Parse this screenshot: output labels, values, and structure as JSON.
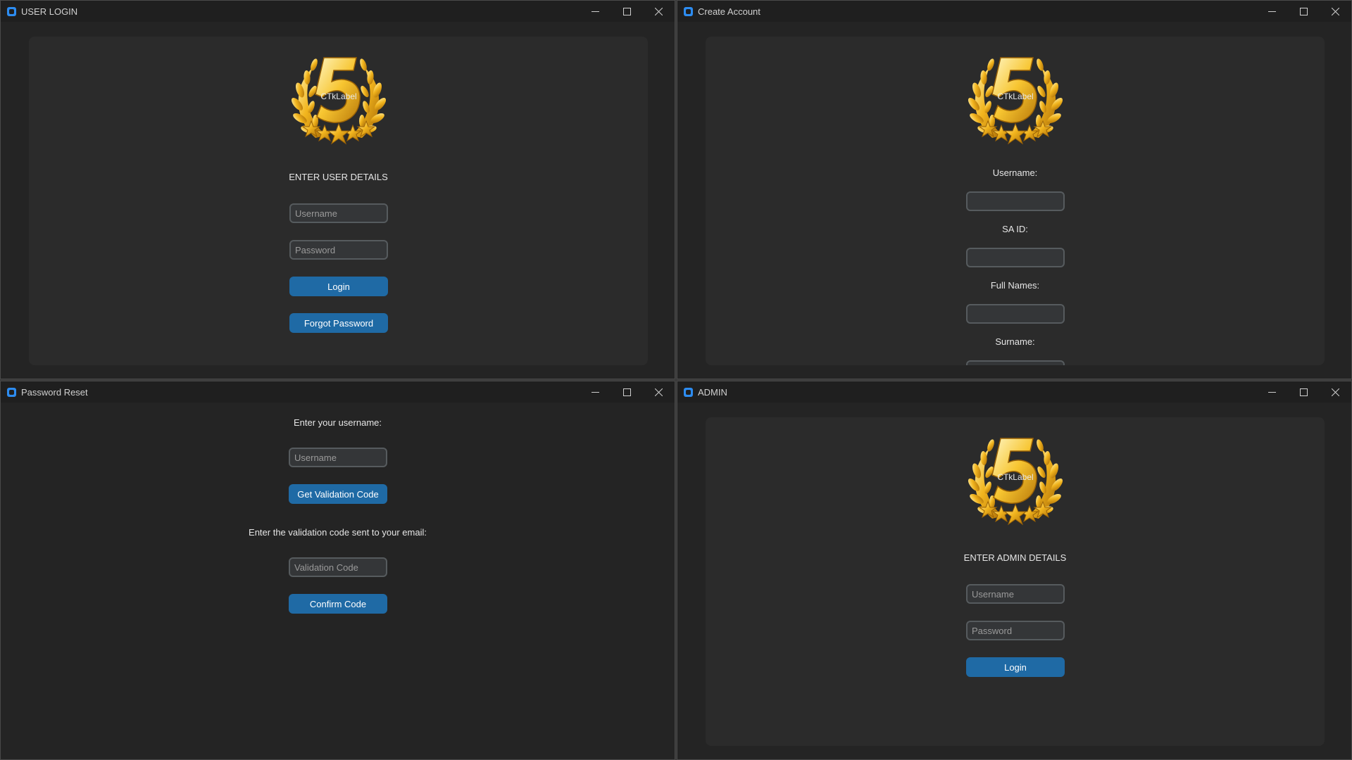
{
  "windows": {
    "login": {
      "title": "USER LOGIN",
      "logo_label": "CTkLabel",
      "heading": "ENTER USER DETAILS",
      "username_placeholder": "Username",
      "password_placeholder": "Password",
      "login_label": "Login",
      "forgot_label": "Forgot Password"
    },
    "create": {
      "title": "Create Account",
      "logo_label": "CTkLabel",
      "username_label": "Username:",
      "said_label": "SA ID:",
      "fullnames_label": "Full Names:",
      "surname_label": "Surname:"
    },
    "reset": {
      "title": "Password Reset",
      "prompt_username": "Enter your username:",
      "username_placeholder": "Username",
      "get_code_label": "Get Validation Code",
      "prompt_code": "Enter the validation code sent to your email:",
      "code_placeholder": "Validation Code",
      "confirm_label": "Confirm Code"
    },
    "admin": {
      "title": "ADMIN",
      "logo_label": "CTkLabel",
      "heading": "ENTER ADMIN DETAILS",
      "username_placeholder": "Username",
      "password_placeholder": "Password",
      "login_label": "Login"
    }
  },
  "icons": {
    "app": "app-icon",
    "minimize": "minimize-icon",
    "maximize": "maximize-icon",
    "close": "close-icon",
    "logo": "gold-laurel-five-star-logo"
  },
  "colors": {
    "window_bg": "#242424",
    "panel_bg": "#2b2b2b",
    "button": "#1f6aa5",
    "entry_border": "#565b5e",
    "gold": "#f2b51e"
  }
}
